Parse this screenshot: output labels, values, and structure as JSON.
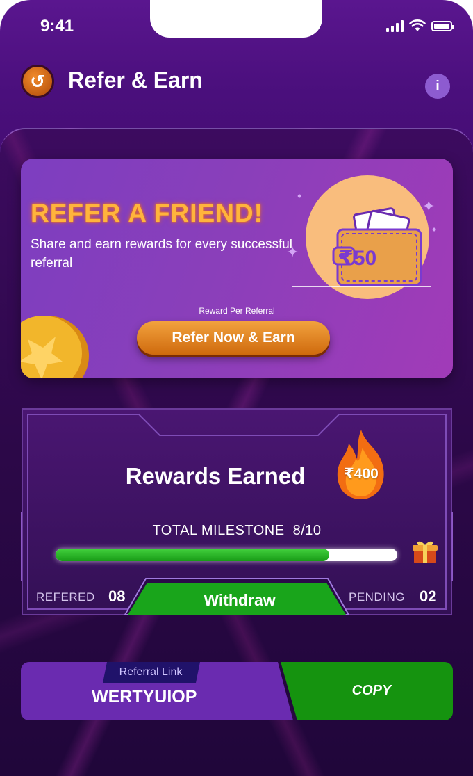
{
  "status_bar": {
    "time": "9:41"
  },
  "header": {
    "title": "Refer & Earn"
  },
  "banner": {
    "headline": "REFER A FRIEND!",
    "subtitle": "Share and earn rewards for every successful referral",
    "wallet_amount": "₹50",
    "reward_caption": "Reward Per Referral",
    "cta_label": "Refer Now & Earn"
  },
  "rewards": {
    "title": "Rewards Earned",
    "earned_amount": "₹400",
    "milestone_label": "TOTAL MILESTONE",
    "milestone_count": "8/10",
    "milestone_progress": 0.8,
    "referred_label": "REFERED",
    "referred_value": "08",
    "pending_label": "PENDING",
    "pending_value": "02",
    "withdraw_label": "Withdraw"
  },
  "referral": {
    "tag_label": "Referral Link",
    "code": "WERTYUIOP",
    "copy_label": "COPY"
  },
  "colors": {
    "accent_orange": "#e07a18",
    "progress_green": "#22a81f",
    "purple_dark": "#2c0848"
  }
}
